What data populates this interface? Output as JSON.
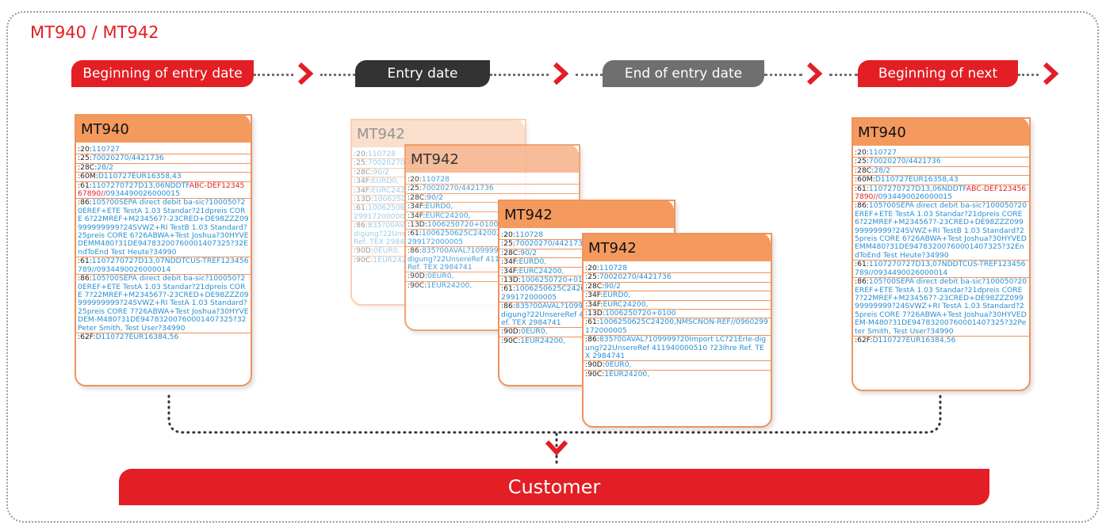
{
  "title": "MT940 / MT942",
  "timeline": {
    "beginning_entry": "Beginning of entry date",
    "entry": "Entry date",
    "end_entry": "End of entry date",
    "beginning_next": "Beginning of next day"
  },
  "colors": {
    "red": "#e31e24",
    "dark": "#333333",
    "gray": "#6f6f6f",
    "orange": "#f49a5e",
    "blue": "#2a8fd2"
  },
  "cards": {
    "mt940_left": {
      "title": "MT940",
      "rows": [
        [
          {
            "t": ":20:",
            "c": "tag"
          },
          {
            "t": "110727",
            "c": "val"
          }
        ],
        [
          {
            "t": ":25:",
            "c": "tag"
          },
          {
            "t": "70020270/4421736",
            "c": "val"
          }
        ],
        [
          {
            "t": ":28C:",
            "c": "tag"
          },
          {
            "t": "28/2",
            "c": "val"
          }
        ],
        [
          {
            "t": ":60M:",
            "c": "tag"
          },
          {
            "t": "D110727EUR16358,43",
            "c": "val"
          }
        ],
        [
          {
            "t": ":61:",
            "c": "tag"
          },
          {
            "t": "1107270727D13,06NDDTF",
            "c": "val"
          },
          {
            "t": "ABC-DEF1234567890//",
            "c": "red"
          },
          {
            "t": "0934490026000015",
            "c": "val"
          }
        ],
        [
          {
            "t": ":86:",
            "c": "tag"
          },
          {
            "t": "105?00SEPA direct debit ba-sic?100050?20EREF+ETE TestA 1.03 Standar?21dpreis CORE 6?22MREF+M234567?-23CRED+DE98ZZZ09999999999?24SVWZ+RI TestB 1.03 Standard?25preis CORE 6?26ABWA+Test Joshua?30HYVEDEMM480?31DE94783200760001407325?32EndToEnd Test Heute?34990",
            "c": "val"
          }
        ],
        [
          {
            "t": ":61:",
            "c": "tag"
          },
          {
            "t": "1107270727D13,07NDDTCUS-TREF123456789//0934490026000014",
            "c": "val"
          }
        ],
        [
          {
            "t": ":86:",
            "c": "tag"
          },
          {
            "t": "105?00SEPA direct debit ba-sic?100050?20EREF+ETE TestA 1.03 Standar?21dpreis CORE 7?22MREF+M234567?-23CRED+DE98ZZZ09999999999?24SVWZ+RI TestA 1.03 Standard?25preis CORE 7?26ABWA+Test Joshua?30HYVEDEM-M480?31DE94783200760001407325?32Peter Smith, Test User?34990",
            "c": "val"
          }
        ],
        [
          {
            "t": ":62F:",
            "c": "tag"
          },
          {
            "t": "D110727EUR16384,56",
            "c": "val"
          }
        ]
      ]
    },
    "mt940_right": {
      "title": "MT940",
      "rows": [
        [
          {
            "t": ":20:",
            "c": "tag"
          },
          {
            "t": "110727",
            "c": "val"
          }
        ],
        [
          {
            "t": ":25:",
            "c": "tag"
          },
          {
            "t": "70020270/4421736",
            "c": "val"
          }
        ],
        [
          {
            "t": ":28C:",
            "c": "tag"
          },
          {
            "t": "28/2",
            "c": "val"
          }
        ],
        [
          {
            "t": ":60M:",
            "c": "tag"
          },
          {
            "t": "D110727EUR16358,43",
            "c": "val"
          }
        ],
        [
          {
            "t": ":61:",
            "c": "tag"
          },
          {
            "t": "1107270727D13,06NDDTF",
            "c": "val"
          },
          {
            "t": "ABC-DEF1234567890//",
            "c": "red"
          },
          {
            "t": "0934490026000015",
            "c": "val"
          }
        ],
        [
          {
            "t": ":86:",
            "c": "tag"
          },
          {
            "t": "105?00SEPA direct debit ba-sic?100050?20EREF+ETE TestA 1.03 Standar?21dpreis CORE 6?22MREF+M234567?-23CRED+DE98ZZZ09999999999?24SVWZ+RI TestB 1.03 Standard?25preis CORE 6?26ABWA+Test Joshua?30HYVEDEMM480?31DE94783200760001407325?32EndToEnd Test Heute?34990",
            "c": "val"
          }
        ],
        [
          {
            "t": ":61:",
            "c": "tag"
          },
          {
            "t": "1107270727D13,07NDDTCUS-TREF123456789//0934490026000014",
            "c": "val"
          }
        ],
        [
          {
            "t": ":86:",
            "c": "tag"
          },
          {
            "t": "105?00SEPA direct debit ba-sic?100050?20EREF+ETE TestA 1.03 Standar?21dpreis CORE 7?22MREF+M234567?-23CRED+DE98ZZZ09999999999?24SVWZ+RI TestA 1.03 Standard?25preis CORE 7?26ABWA+Test Joshua?30HYVEDEM-M480?31DE94783200760001407325?32Peter Smith, Test User?34990",
            "c": "val"
          }
        ],
        [
          {
            "t": ":62F:",
            "c": "tag"
          },
          {
            "t": "D110727EUR16384,56",
            "c": "val"
          }
        ]
      ]
    },
    "mt942_1": {
      "title": "MT942",
      "rows": [
        [
          {
            "t": ":20:",
            "c": "tag"
          },
          {
            "t": "110728",
            "c": "val"
          }
        ],
        [
          {
            "t": ":25:",
            "c": "tag"
          },
          {
            "t": "70020270/4421736",
            "c": "val"
          }
        ],
        [
          {
            "t": ":28C:",
            "c": "tag"
          },
          {
            "t": "90/2",
            "c": "val"
          }
        ],
        [
          {
            "t": ":34F:",
            "c": "tag"
          },
          {
            "t": "EURD0,",
            "c": "val"
          }
        ],
        [
          {
            "t": ":34F:",
            "c": "tag"
          },
          {
            "t": "EURC24200,",
            "c": "val"
          }
        ],
        [
          {
            "t": ":13D:",
            "c": "tag"
          },
          {
            "t": "1006250720+0100",
            "c": "val"
          }
        ],
        [
          {
            "t": ":61:",
            "c": "tag"
          },
          {
            "t": "1006250625C24200,NMSCNON-REF//0960299172000005",
            "c": "val"
          }
        ],
        [
          {
            "t": ":86:",
            "c": "tag"
          },
          {
            "t": "835?00AVAL?109999?20Import LC?21Erle-digung?22UnsereRef 411940000510 ?23Ihre Ref. TEX 2984741",
            "c": "val"
          }
        ],
        [
          {
            "t": ":90D:",
            "c": "tag"
          },
          {
            "t": "0EUR0,",
            "c": "val"
          }
        ],
        [
          {
            "t": ":90C:",
            "c": "tag"
          },
          {
            "t": "1EUR24200,",
            "c": "val"
          }
        ]
      ]
    },
    "mt942_2": {
      "title": "MT942",
      "rows": [
        [
          {
            "t": ":20:",
            "c": "tag"
          },
          {
            "t": "110728",
            "c": "val"
          }
        ],
        [
          {
            "t": ":25:",
            "c": "tag"
          },
          {
            "t": "70020270/4421736",
            "c": "val"
          }
        ],
        [
          {
            "t": ":28C:",
            "c": "tag"
          },
          {
            "t": "90/2",
            "c": "val"
          }
        ],
        [
          {
            "t": ":34F:",
            "c": "tag"
          },
          {
            "t": "EURD0,",
            "c": "val"
          }
        ],
        [
          {
            "t": ":34F:",
            "c": "tag"
          },
          {
            "t": "EURC24200,",
            "c": "val"
          }
        ],
        [
          {
            "t": ":13D:",
            "c": "tag"
          },
          {
            "t": "1006250720+0100",
            "c": "val"
          }
        ],
        [
          {
            "t": ":61:",
            "c": "tag"
          },
          {
            "t": "1006250625C24200,NMSCNON-REF//0960299172000005",
            "c": "val"
          }
        ],
        [
          {
            "t": ":86:",
            "c": "tag"
          },
          {
            "t": "835?00AVAL?109999?20Import LC?21Erle-digung?22UnsereRef 411940000510 ?23Ihre Ref. TEX 2984741",
            "c": "val"
          }
        ],
        [
          {
            "t": ":90D:",
            "c": "tag"
          },
          {
            "t": "0EUR0,",
            "c": "val"
          }
        ],
        [
          {
            "t": ":90C:",
            "c": "tag"
          },
          {
            "t": "1EUR24200,",
            "c": "val"
          }
        ]
      ]
    },
    "mt942_3": {
      "title": "MT942",
      "rows": [
        [
          {
            "t": ":20:",
            "c": "tag"
          },
          {
            "t": "110728",
            "c": "val"
          }
        ],
        [
          {
            "t": ":25:",
            "c": "tag"
          },
          {
            "t": "70020270/4421736",
            "c": "val"
          }
        ],
        [
          {
            "t": ":28C:",
            "c": "tag"
          },
          {
            "t": "90/2",
            "c": "val"
          }
        ],
        [
          {
            "t": ":34F:",
            "c": "tag"
          },
          {
            "t": "EURD0,",
            "c": "val"
          }
        ],
        [
          {
            "t": ":34F:",
            "c": "tag"
          },
          {
            "t": "EURC24200,",
            "c": "val"
          }
        ],
        [
          {
            "t": ":13D:",
            "c": "tag"
          },
          {
            "t": "1006250720+0100",
            "c": "val"
          }
        ],
        [
          {
            "t": ":61:",
            "c": "tag"
          },
          {
            "t": "1006250625C24200,NMSCNON-REF//0960299172000005",
            "c": "val"
          }
        ],
        [
          {
            "t": ":86:",
            "c": "tag"
          },
          {
            "t": "835?00AVAL?109999?20Import LC?21Erle-digung?22UnsereRef 411940000510 ?23Ihre Ref. TEX 2984741",
            "c": "val"
          }
        ],
        [
          {
            "t": ":90D:",
            "c": "tag"
          },
          {
            "t": "0EUR0,",
            "c": "val"
          }
        ],
        [
          {
            "t": ":90C:",
            "c": "tag"
          },
          {
            "t": "1EUR24200,",
            "c": "val"
          }
        ]
      ]
    },
    "mt942_4": {
      "title": "MT942",
      "rows": [
        [
          {
            "t": ":20:",
            "c": "tag"
          },
          {
            "t": "110728",
            "c": "val"
          }
        ],
        [
          {
            "t": ":25:",
            "c": "tag"
          },
          {
            "t": "70020270/4421736",
            "c": "val"
          }
        ],
        [
          {
            "t": ":28C:",
            "c": "tag"
          },
          {
            "t": "90/2",
            "c": "val"
          }
        ],
        [
          {
            "t": ":34F:",
            "c": "tag"
          },
          {
            "t": "EURD0,",
            "c": "val"
          }
        ],
        [
          {
            "t": ":34F:",
            "c": "tag"
          },
          {
            "t": "EURC24200,",
            "c": "val"
          }
        ],
        [
          {
            "t": ":13D:",
            "c": "tag"
          },
          {
            "t": "1006250720+0100",
            "c": "val"
          }
        ],
        [
          {
            "t": ":61:",
            "c": "tag"
          },
          {
            "t": "1006250625C24200,NMSCNON-REF//0960299172000005",
            "c": "val"
          }
        ],
        [
          {
            "t": ":86:",
            "c": "tag"
          },
          {
            "t": "835?00AVAL?109999?20Import LC?21Erle-digung?22UnsereRef 411940000510 ?23Ihre Ref. TEX 2984741",
            "c": "val"
          }
        ],
        [
          {
            "t": ":90D:",
            "c": "tag"
          },
          {
            "t": "0EUR0,",
            "c": "val"
          }
        ],
        [
          {
            "t": ":90C:",
            "c": "tag"
          },
          {
            "t": "1EUR24200,",
            "c": "val"
          }
        ]
      ]
    }
  },
  "customer_label": "Customer"
}
